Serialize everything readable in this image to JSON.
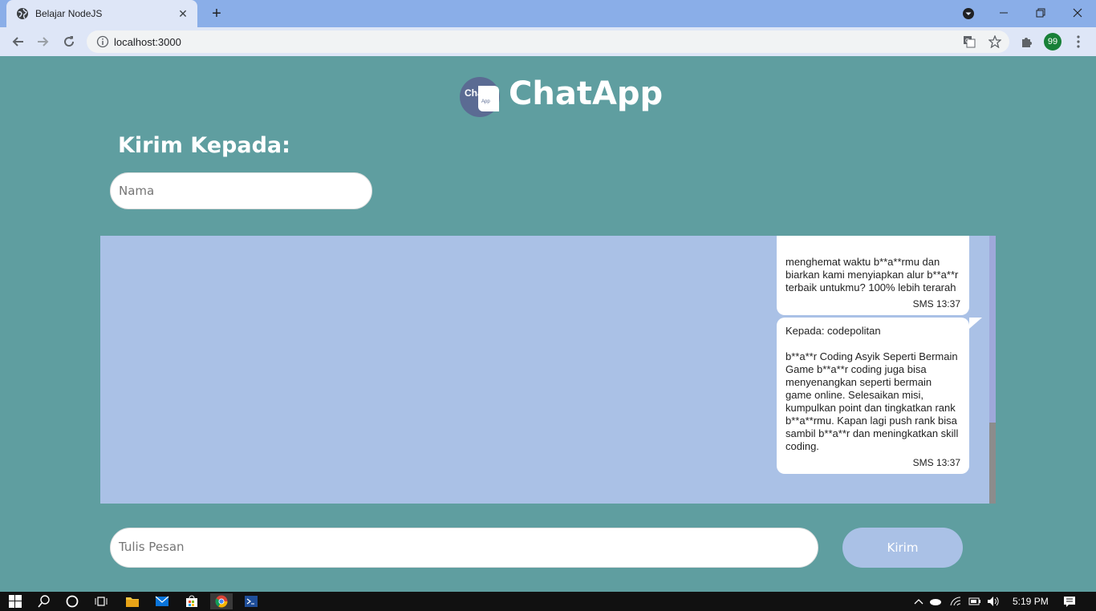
{
  "browser": {
    "tab_title": "Belajar NodeJS",
    "new_tab": "+",
    "url": "localhost:3000",
    "profile_badge": "99"
  },
  "app": {
    "title": "ChatApp",
    "logo_text": "Chat",
    "logo_subtext": "App",
    "recipient_label": "Kirim Kepada:",
    "recipient_placeholder": "Nama",
    "message_placeholder": "Tulis Pesan",
    "send_label": "Kirim"
  },
  "messages": [
    {
      "text": "menghemat waktu b**a**rmu dan biarkan kami menyiapkan alur b**a**r terbaik untukmu? 100% lebih terarah",
      "meta": "SMS 13:37"
    },
    {
      "text": "Kepada: codepolitan\n\nb**a**r Coding Asyik Seperti Bermain Game b**a**r coding juga bisa menyenangkan seperti bermain game online. Selesaikan misi, kumpulkan point dan tingkatkan rank b**a**rmu. Kapan lagi push rank bisa sambil b**a**r dan meningkatkan skill coding.",
      "meta": "SMS 13:37"
    }
  ],
  "taskbar": {
    "clock": "5:19 PM"
  },
  "colors": {
    "page_bg": "#5f9ea0",
    "chat_bg": "#aac1e6",
    "button_bg": "#aac1e6",
    "logo_bg": "#5b6b93"
  }
}
